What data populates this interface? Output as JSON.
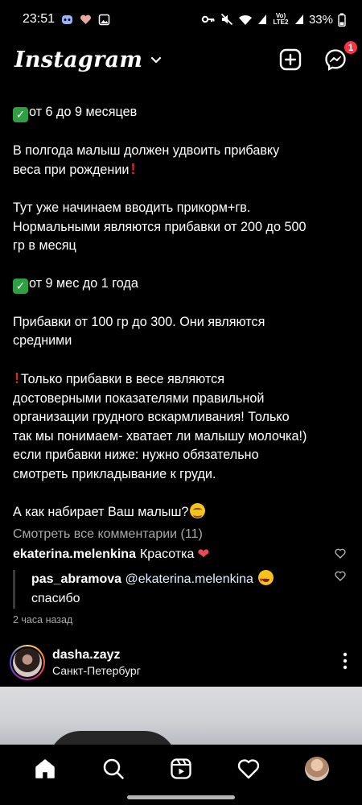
{
  "status_bar": {
    "time": "23:51",
    "network_label": "Vo) LTE2",
    "battery": "33%"
  },
  "header": {
    "logo": "Instagram",
    "messages_badge": "1"
  },
  "caption": {
    "line_1": "от 6 до 9 месяцев",
    "line_2a": "В полгода малыш должен удвоить прибавку",
    "line_2b": "веса при рождении",
    "line_3a": "Тут уже начинаем вводить прикорм+гв.",
    "line_3b": "Нормальными являются прибавки от 200 до 500",
    "line_3c": "гр в месяц",
    "line_4": "от 9 мес до 1 года",
    "line_5a": "Прибавки от 100 гр до 300. Они являются",
    "line_5b": "средними",
    "line_6a": "Только прибавки в весе являются",
    "line_6b": "достоверными показателями правильной",
    "line_6c": "организации грудного вскармливания! Только",
    "line_6d": "так мы понимаем- хватает ли малышу молочка!)",
    "line_6e": "если прибавки ниже: нужно обязательно",
    "line_6f": "смотреть прикладывание к груди.",
    "line_7": "А как набирает Ваш малыш?"
  },
  "comments": {
    "view_all": "Смотреть все комментарии (11)",
    "c1_user": "ekaterina.melenkina",
    "c1_text": "Красотка",
    "r1_user": "pas_abramova",
    "r1_mention": "@ekaterina.melenkina",
    "r1_text": "спасибо",
    "time_ago": "2 часа назад"
  },
  "next_post": {
    "username": "dasha.zayz",
    "location": "Санкт-Петербург"
  },
  "colors": {
    "background": "#000000",
    "badge": "#ff3040",
    "like_red": "#ed4956",
    "muted_text": "#a8a8a8"
  }
}
